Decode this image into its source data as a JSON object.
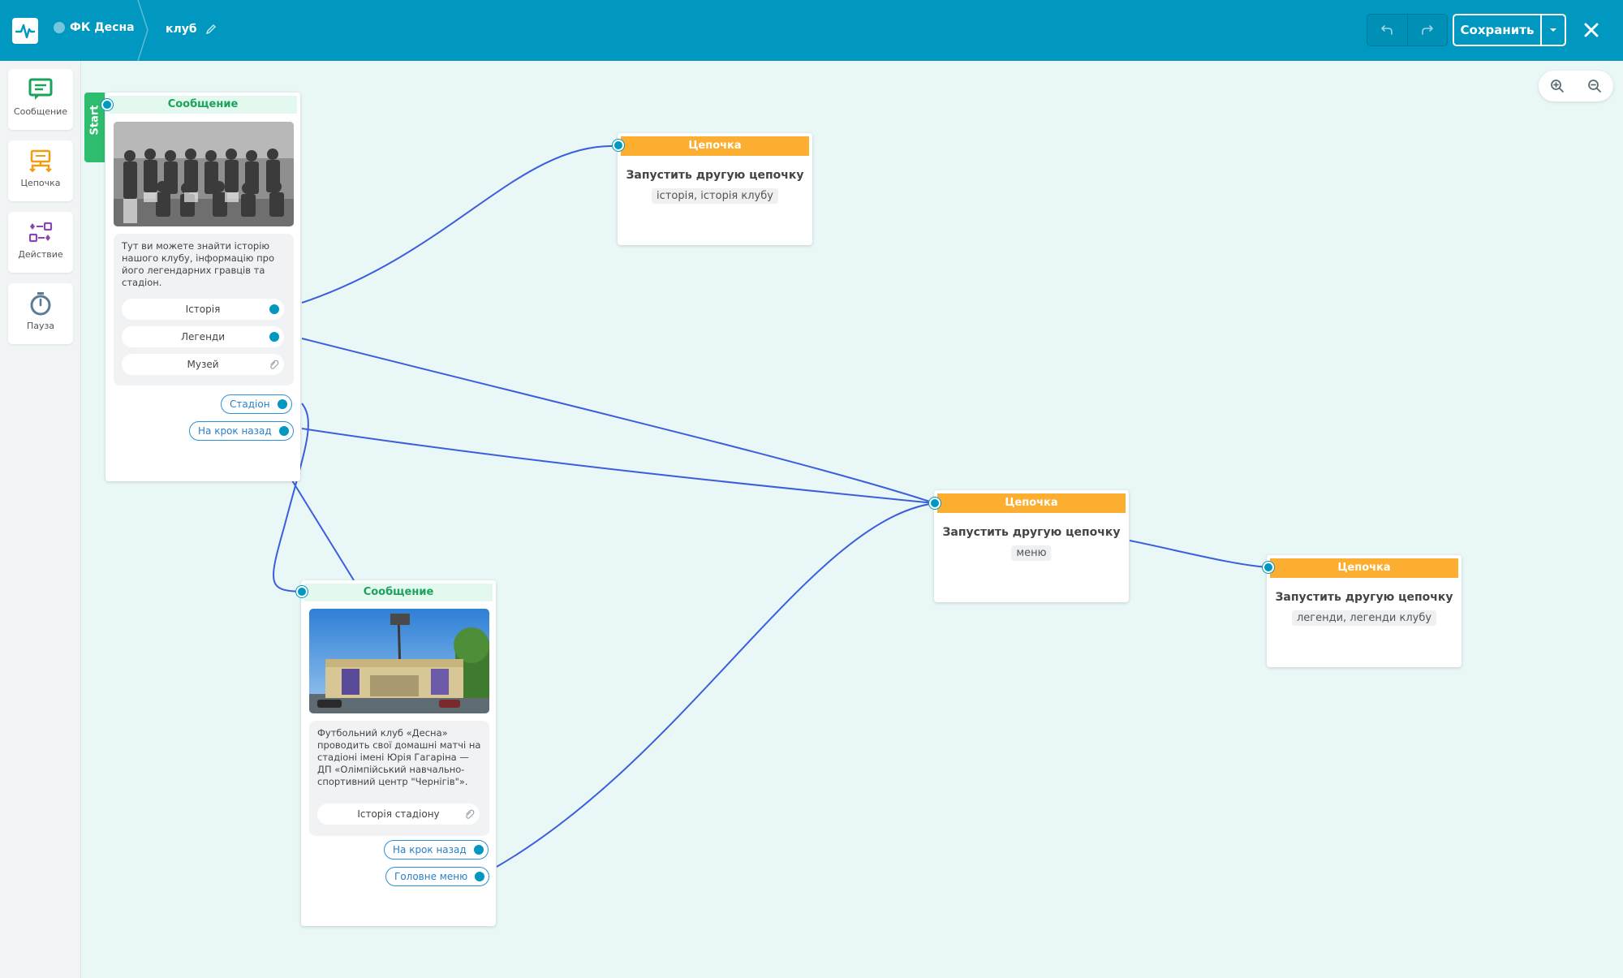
{
  "header": {
    "bot_name": "ФК Десна",
    "flow_name": "клуб",
    "save_label": "Сохранить"
  },
  "sidebar": {
    "tools": [
      {
        "label": "Сообщение",
        "icon": "message-icon",
        "color": "#1aa35b"
      },
      {
        "label": "Цепочка",
        "icon": "chain-icon",
        "color": "#f39c12"
      },
      {
        "label": "Действие",
        "icon": "action-icon",
        "color": "#8e44ad"
      },
      {
        "label": "Пауза",
        "icon": "timer-icon",
        "color": "#5b7c99"
      }
    ]
  },
  "canvas": {
    "start_label": "Start",
    "message_1": {
      "header": "Сообщение",
      "text": "Тут ви можете знайти історію нашого клубу, інформацію про його легендарних гравців та стадіон.",
      "buttons": [
        "Історія",
        "Легенди",
        "Музей"
      ],
      "quick_replies": [
        "Стадіон",
        "На крок назад"
      ]
    },
    "message_2": {
      "header": "Сообщение",
      "text": "Футбольний клуб «Десна» проводить свої домашні матчі на стадіоні імені Юрія Гагаріна — ДП «Олімпійський навчально-спортивний центр \"Чернігів\"».",
      "buttons": [
        "Історія стадіону"
      ],
      "quick_replies": [
        "На крок назад",
        "Головне меню"
      ]
    },
    "chain_1": {
      "header": "Цепочка",
      "title": "Запустить другую цепочку",
      "tag": "історія, історія клубу"
    },
    "chain_2": {
      "header": "Цепочка",
      "title": "Запустить другую цепочку",
      "tag": "меню"
    },
    "chain_3": {
      "header": "Цепочка",
      "title": "Запустить другую цепочку",
      "tag": "легенди, легенди клубу"
    }
  },
  "colors": {
    "header_bg": "#0098c0",
    "canvas_bg": "#eaf7f7",
    "connector": "#3a5fdc",
    "chain_accent": "#fbae30",
    "message_accent": "#1aa35b",
    "start_tab": "#2ebd6f"
  }
}
